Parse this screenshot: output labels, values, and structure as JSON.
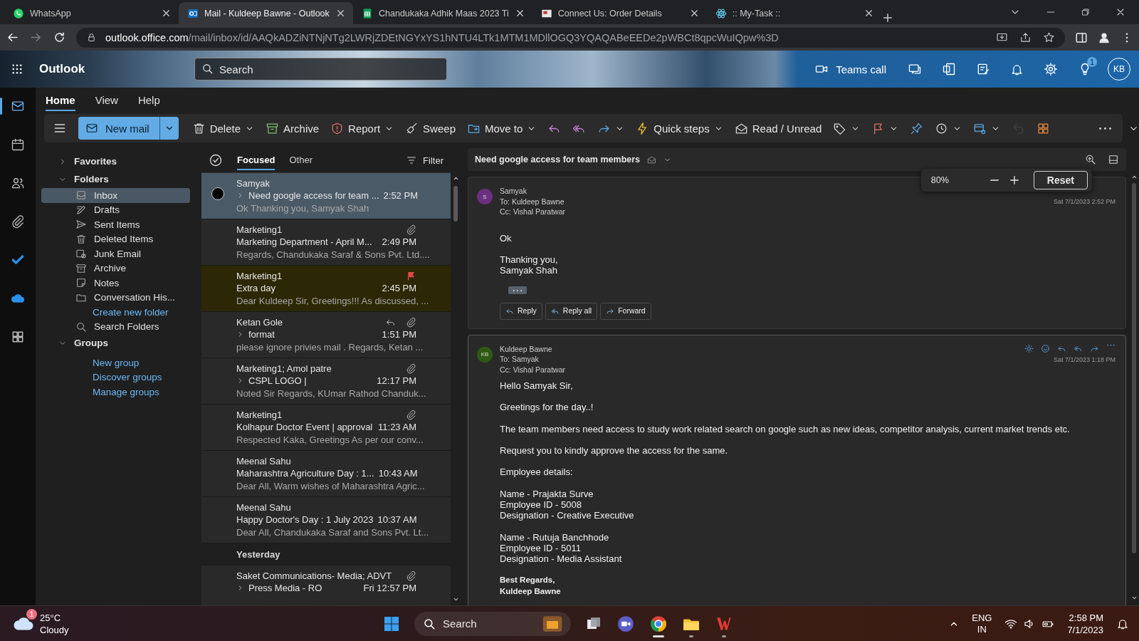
{
  "browser": {
    "tabs": [
      {
        "title": "WhatsApp",
        "selected": false
      },
      {
        "title": "Mail - Kuldeep Bawne - Outlook",
        "selected": true
      },
      {
        "title": "Chandukaka Adhik Maas 2023 Ti",
        "selected": false
      },
      {
        "title": "Connect Us: Order Details",
        "selected": false
      },
      {
        "title": ":: My-Task ::",
        "selected": false
      }
    ],
    "url_host": "outlook.office.com",
    "url_path": "/mail/inbox/id/AAQkADZiNTNjNTg2LWRjZDEtNGYxYS1hNTU4LTk1MTM1MDllOGQ3YQAQABeEEDe2pWBCt8qpcWuIQpw%3D"
  },
  "header": {
    "app_name": "Outlook",
    "search_placeholder": "Search",
    "teams_call": "Teams call",
    "tips_badge": "1",
    "avatar": "KB"
  },
  "app_rail": [
    {
      "selected": true
    },
    {
      "selected": false
    },
    {
      "selected": false
    },
    {
      "selected": false
    },
    {
      "selected": false
    },
    {
      "selected": false
    },
    {
      "selected": false
    }
  ],
  "ribbon": {
    "tabs": [
      {
        "label": "Home",
        "selected": true
      },
      {
        "label": "View",
        "selected": false
      },
      {
        "label": "Help",
        "selected": false
      }
    ],
    "new_mail": "New mail",
    "commands": [
      {
        "label": "Delete",
        "dropdown": true,
        "disabled": false
      },
      {
        "label": "Archive",
        "dropdown": false,
        "disabled": false
      },
      {
        "label": "Report",
        "dropdown": true,
        "disabled": false
      },
      {
        "label": "Sweep",
        "dropdown": false,
        "disabled": false
      },
      {
        "label": "Move to",
        "dropdown": true,
        "disabled": false
      },
      {
        "dropdown": false,
        "disabled": false
      },
      {
        "dropdown": false,
        "disabled": false
      },
      {
        "dropdown": true,
        "disabled": false
      },
      {
        "label": "Quick steps",
        "dropdown": true,
        "disabled": false
      },
      {
        "label": "Read / Unread",
        "dropdown": false,
        "disabled": false
      },
      {
        "dropdown": true,
        "disabled": false
      },
      {
        "dropdown": true,
        "disabled": false
      },
      {
        "dropdown": false,
        "disabled": false
      },
      {
        "dropdown": true,
        "disabled": false
      },
      {
        "dropdown": true,
        "disabled": false
      },
      {
        "dropdown": false,
        "disabled": true
      },
      {
        "dropdown": false,
        "disabled": false
      },
      {
        "dropdown": false,
        "disabled": false
      }
    ]
  },
  "folders": {
    "favorites": {
      "label": "Favorites",
      "expanded": false
    },
    "folders": {
      "label": "Folders",
      "expanded": true
    },
    "items": [
      {
        "label": "Inbox",
        "selected": true
      },
      {
        "label": "Drafts",
        "selected": false
      },
      {
        "label": "Sent Items",
        "selected": false
      },
      {
        "label": "Deleted Items",
        "selected": false
      },
      {
        "label": "Junk Email",
        "selected": false
      },
      {
        "label": "Archive",
        "selected": false
      },
      {
        "label": "Notes",
        "selected": false
      },
      {
        "label": "Conversation His...",
        "selected": false
      }
    ],
    "create_folder": "Create new folder",
    "search_folders": "Search Folders",
    "groups": {
      "label": "Groups",
      "expanded": true
    },
    "group_links": [
      "New group",
      "Discover groups",
      "Manage groups"
    ]
  },
  "mail_list": {
    "tabs": [
      {
        "label": "Focused",
        "selected": true
      },
      {
        "label": "Other",
        "selected": false
      }
    ],
    "filter": "Filter",
    "entries": [
      {
        "kind": "message",
        "sender": "Samyak",
        "subject": "Need google access for team ...",
        "time": "2:52 PM",
        "preview": "Ok Thanking you, Samyak Shah",
        "selected": true,
        "flagged": false,
        "attachment": false,
        "replied": false,
        "thread": true
      },
      {
        "kind": "message",
        "sender": "Marketing1",
        "subject": "Marketing Department - April M...",
        "time": "2:49 PM",
        "preview": "Regards, Chandukaka Saraf & Sons Pvt. Ltd....",
        "selected": false,
        "flagged": false,
        "attachment": true,
        "replied": false,
        "thread": false
      },
      {
        "kind": "message",
        "sender": "Marketing1",
        "subject": "Extra day",
        "time": "2:45 PM",
        "preview": "Dear Kuldeep Sir, Greetings!!! As discussed, ...",
        "selected": false,
        "flagged": true,
        "attachment": false,
        "replied": false,
        "thread": false
      },
      {
        "kind": "message",
        "sender": "Ketan Gole",
        "subject": "format",
        "time": "1:51 PM",
        "preview": "please ignore privies mail . Regards, Ketan ...",
        "selected": false,
        "flagged": false,
        "attachment": true,
        "replied": true,
        "thread": true
      },
      {
        "kind": "message",
        "sender": "Marketing1; Amol patre",
        "subject": "CSPL LOGO |",
        "time": "12:17 PM",
        "preview": "Noted Sir Regards, KUmar Rathod Chanduk...",
        "selected": false,
        "flagged": false,
        "attachment": true,
        "replied": false,
        "thread": true
      },
      {
        "kind": "message",
        "sender": "Marketing1",
        "subject": "Kolhapur Doctor Event | approval",
        "time": "11:23 AM",
        "preview": "Respected Kaka, Greetings As per our conv...",
        "selected": false,
        "flagged": false,
        "attachment": true,
        "replied": false,
        "thread": false
      },
      {
        "kind": "message",
        "sender": "Meenal Sahu",
        "subject": "Maharashtra Agriculture Day : 1...",
        "time": "10:43 AM",
        "preview": "Dear All, Warm wishes of Maharashtra Agric...",
        "selected": false,
        "flagged": false,
        "attachment": false,
        "replied": false,
        "thread": false
      },
      {
        "kind": "message",
        "sender": "Meenal Sahu",
        "subject": "Happy Doctor's Day : 1 July 2023",
        "time": "10:37 AM",
        "preview": "Dear All, Chandukaka Saraf and Sons Pvt. Lt...",
        "selected": false,
        "flagged": false,
        "attachment": false,
        "replied": false,
        "thread": false
      },
      {
        "kind": "date_header",
        "label": "Yesterday"
      },
      {
        "kind": "message",
        "sender": "Saket Communications- Media; ADVT",
        "subject": "Press Media - RO",
        "time": "Fri 12:57 PM",
        "selected": false,
        "flagged": false,
        "attachment": true,
        "replied": false,
        "thread": true
      }
    ]
  },
  "reading_pane": {
    "subject": "Need google access for team members",
    "zoom": {
      "value": "80%",
      "reset": "Reset"
    },
    "messages": [
      {
        "avatar": "S",
        "color": "#6b2f80",
        "sender": "Samyak",
        "to": "To: Kuldeep Bawne",
        "cc": "Cc: Vishal Paratwar",
        "date": "Sat 7/1/2023 2:52 PM",
        "toolbar": false,
        "trimmed": true,
        "paragraphs": [
          {
            "lines": [
              "Ok"
            ],
            "bold": false
          },
          {
            "lines": [
              "Thanking you,",
              "Samyak Shah"
            ],
            "bold": false
          }
        ],
        "actions": [
          "Reply",
          "Reply all",
          "Forward"
        ]
      },
      {
        "avatar": "KB",
        "color": "#2e5a12",
        "sender": "Kuldeep Bawne",
        "to": "To: Samyak",
        "cc": "Cc: Vishal Paratwar",
        "date": "Sat 7/1/2023 1:18 PM",
        "toolbar": true,
        "trimmed": false,
        "paragraphs": [
          {
            "lines": [
              "Hello Samyak Sir,"
            ],
            "bold": false
          },
          {
            "lines": [
              "Greetings for the day..!"
            ],
            "bold": false
          },
          {
            "lines": [
              "The team members need access to study work related search on google such as new ideas, competitor analysis, current market trends etc."
            ],
            "bold": false
          },
          {
            "lines": [
              "Request you to kindly approve the access for the same."
            ],
            "bold": false
          },
          {
            "lines": [
              "Employee details:"
            ],
            "bold": false
          },
          {
            "lines": [
              "Name - Prajakta Surve",
              "Employee ID - 5008",
              "Designation - Creative Executive"
            ],
            "bold": false
          },
          {
            "lines": [
              "Name - Rutuja Banchhode",
              "Employee ID - 5011",
              "Designation - Media Assistant"
            ],
            "bold": false
          },
          {
            "lines": [
              "Best Regards,",
              "Kuldeep Bawne"
            ],
            "bold": true
          }
        ]
      }
    ]
  },
  "taskbar": {
    "weather_temp": "25°C",
    "weather_text": "Cloudy",
    "weather_badge": "1",
    "search_placeholder": "Search",
    "lang": "ENG",
    "region": "IN",
    "time": "2:58 PM",
    "date": "7/1/2023"
  }
}
